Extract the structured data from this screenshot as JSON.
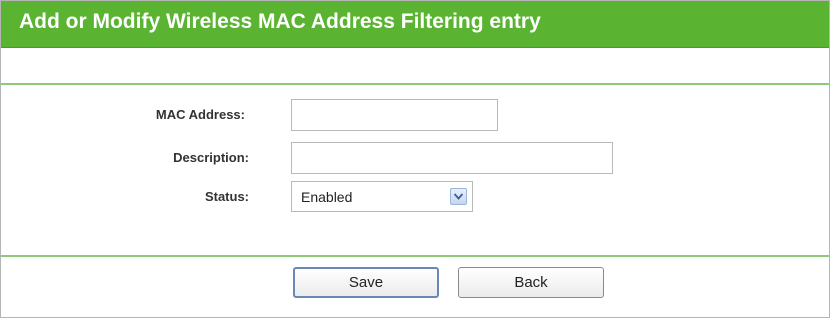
{
  "header": {
    "title": "Add or Modify Wireless MAC Address Filtering entry"
  },
  "form": {
    "mac_address": {
      "label": "MAC Address:",
      "value": ""
    },
    "description": {
      "label": "Description:",
      "value": ""
    },
    "status": {
      "label": "Status:",
      "selected": "Enabled"
    }
  },
  "buttons": {
    "save": "Save",
    "back": "Back"
  },
  "colors": {
    "header_bg": "#5bb431",
    "separator": "#8fc97a"
  },
  "icons": {
    "status_dropdown": "chevron-down-icon"
  }
}
